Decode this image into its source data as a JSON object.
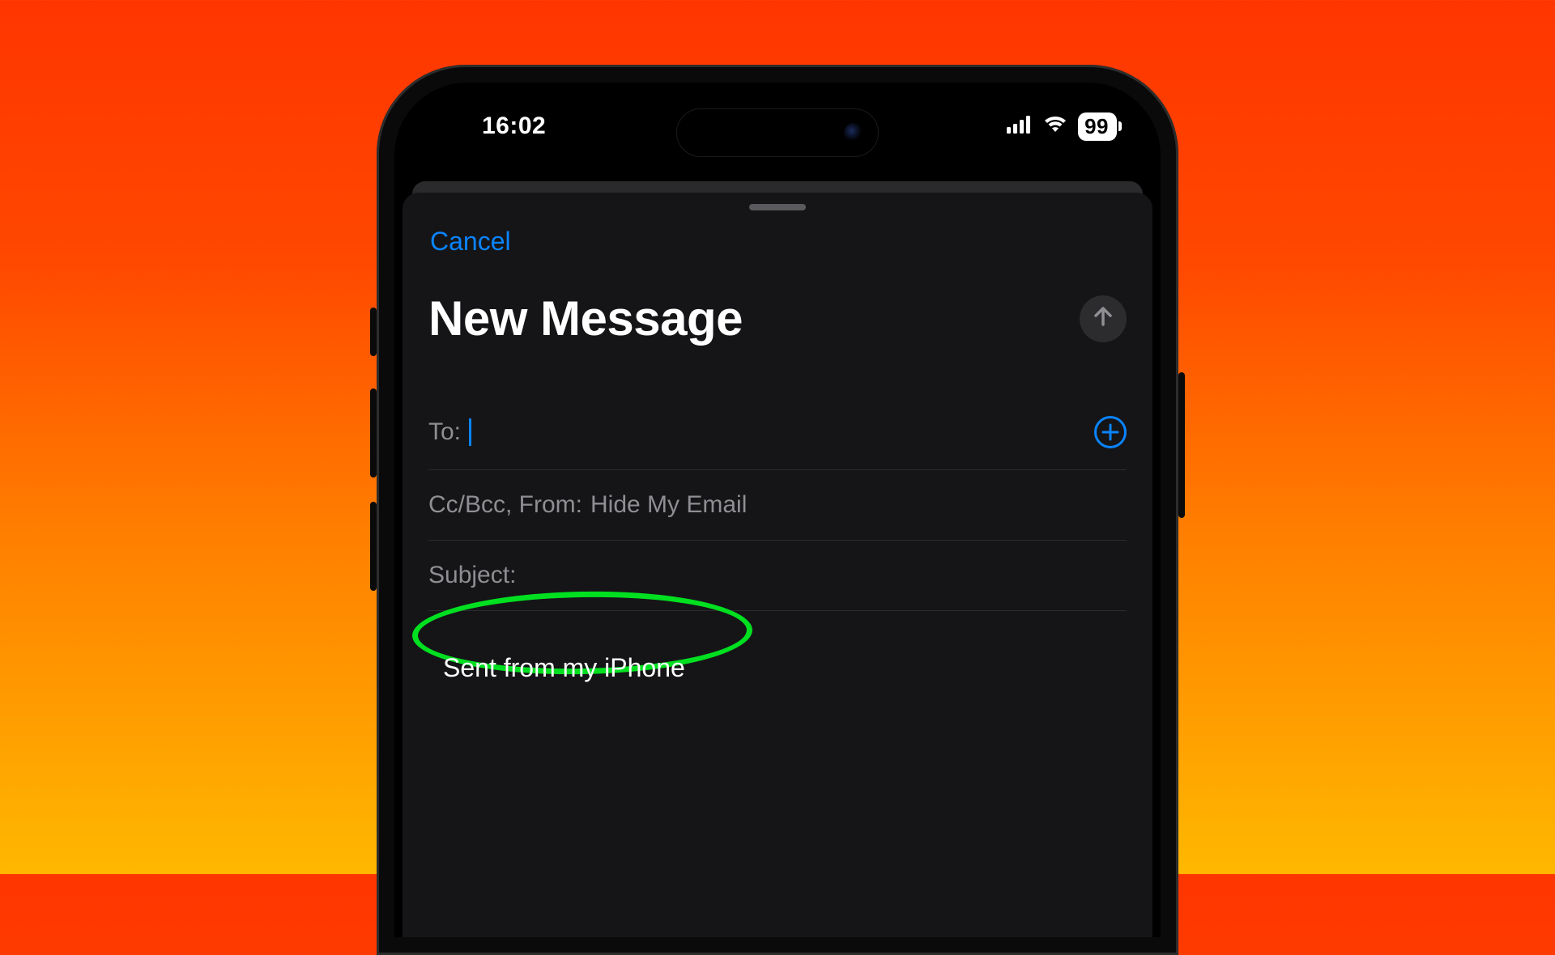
{
  "status": {
    "time": "16:02",
    "battery": "99"
  },
  "sheet": {
    "cancel_label": "Cancel",
    "title": "New Message",
    "fields": {
      "to_label": "To:",
      "ccbcc_label": "Cc/Bcc, From:",
      "from_value": "Hide My Email",
      "subject_label": "Subject:"
    },
    "body_signature": "Sent from my iPhone"
  },
  "colors": {
    "accent": "#0a84ff",
    "highlight": "#00e020"
  }
}
